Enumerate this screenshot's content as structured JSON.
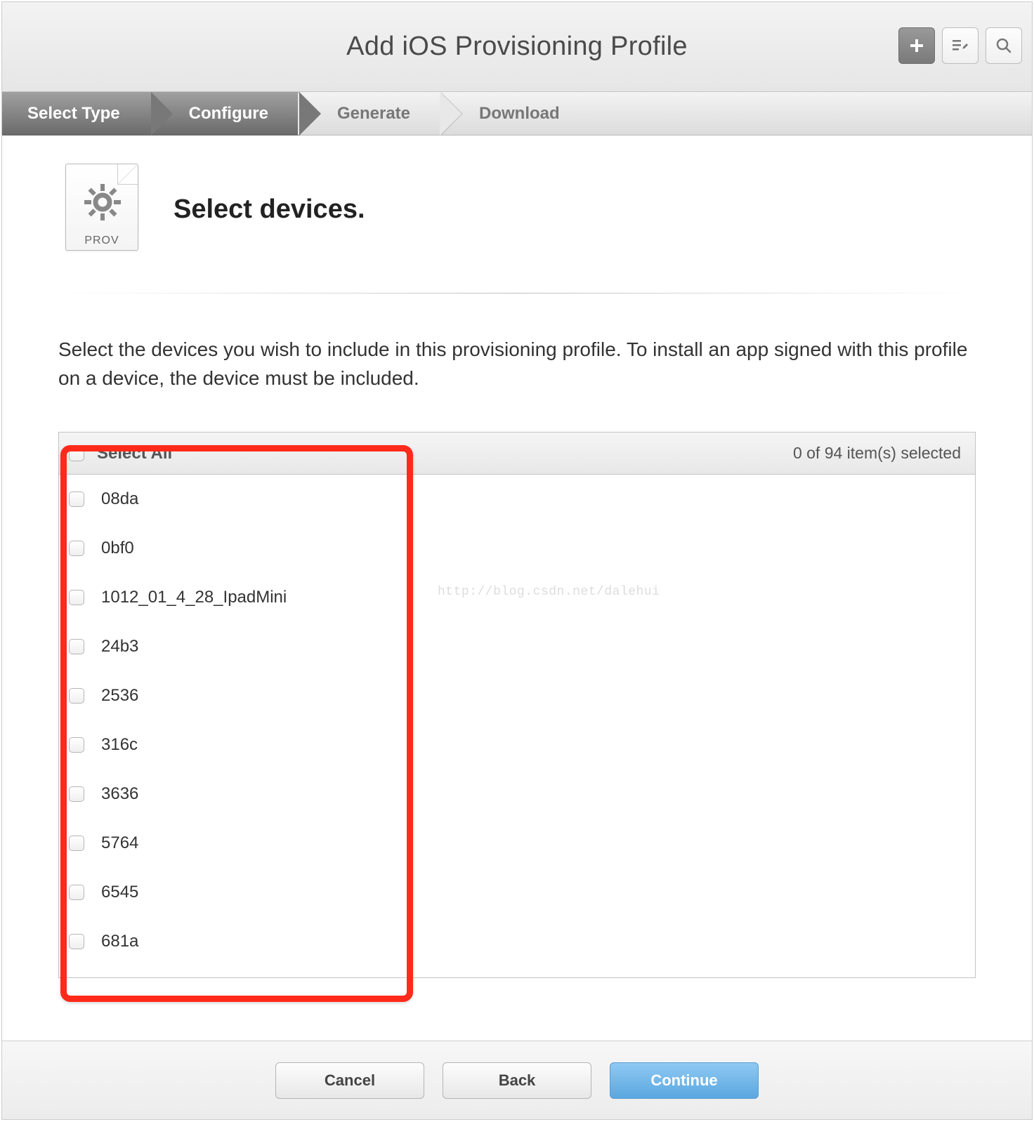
{
  "header": {
    "title": "Add iOS Provisioning Profile"
  },
  "steps": {
    "s1": "Select Type",
    "s2": "Configure",
    "s3": "Generate",
    "s4": "Download"
  },
  "prov_label": "PROV",
  "heading": "Select devices.",
  "instructions": "Select the devices you wish to include in this provisioning profile. To install an app signed with this profile on a device, the device must be included.",
  "table": {
    "select_all": "Select All",
    "count": "0 of 94 item(s) selected"
  },
  "devices": [
    "08da",
    "0bf0",
    "1012_01_4_28_IpadMini",
    "24b3",
    "2536",
    "316c",
    "3636",
    "5764",
    "6545",
    "681a"
  ],
  "watermark": "http://blog.csdn.net/dalehui",
  "buttons": {
    "cancel": "Cancel",
    "back": "Back",
    "continue": "Continue"
  }
}
